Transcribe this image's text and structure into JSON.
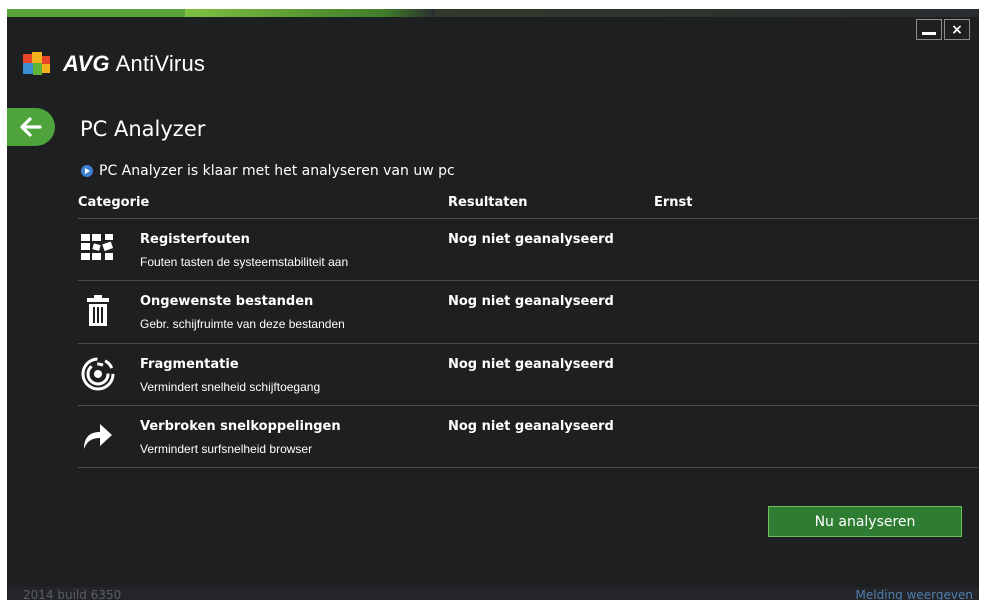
{
  "app": {
    "brand": "AVG",
    "product": "AntiVirus",
    "colors": {
      "accent": "#4ea33a",
      "background": "#1d1f21",
      "info_dot": "#3d7fd1"
    }
  },
  "window_controls": {
    "minimize_icon": "minimize-icon",
    "close_label": "×"
  },
  "page": {
    "title": "PC Analyzer",
    "status_text": "PC Analyzer is klaar met het analyseren van uw pc"
  },
  "table": {
    "headers": {
      "category": "Categorie",
      "results": "Resultaten",
      "severity": "Ernst"
    },
    "rows": [
      {
        "title": "Registerfouten",
        "description": "Fouten tasten de systeemstabiliteit aan",
        "result": "Nog niet geanalyseerd",
        "icon": "registry-icon"
      },
      {
        "title": "Ongewenste bestanden",
        "description": "Gebr. schijfruimte van deze bestanden",
        "result": "Nog niet geanalyseerd",
        "icon": "trash-icon"
      },
      {
        "title": "Fragmentatie",
        "description": "Vermindert snelheid schijftoegang",
        "result": "Nog niet geanalyseerd",
        "icon": "disk-fragment-icon"
      },
      {
        "title": "Verbroken snelkoppelingen",
        "description": "Vermindert surfsnelheid browser",
        "result": "Nog niet geanalyseerd",
        "icon": "shortcut-arrow-icon"
      }
    ]
  },
  "actions": {
    "analyze_label": "Nu analyseren"
  },
  "footer": {
    "build": "2014 build 6350",
    "notify": "Melding weergeven"
  }
}
